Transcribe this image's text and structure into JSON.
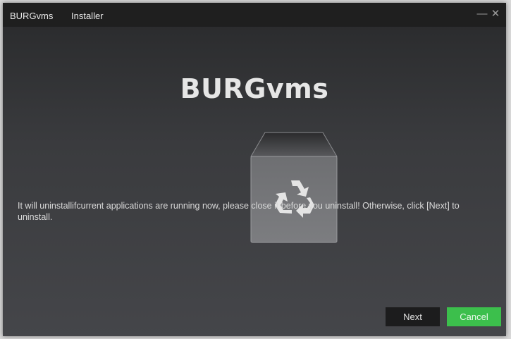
{
  "titlebar": {
    "app_name": "BURGvms",
    "subtitle": "Installer",
    "minimize_glyph": "—",
    "close_glyph": "✕"
  },
  "logo": {
    "text": "BURGvms",
    "icon": "recycle-bin-icon"
  },
  "message": "It will uninstallifcurrent applications are running now, please close it before you uninstall! Otherwise, click [Next] to uninstall.",
  "buttons": {
    "next": "Next",
    "cancel": "Cancel"
  },
  "colors": {
    "cancel_accent": "#3cbf4c",
    "next_background": "#1c1c1d"
  }
}
